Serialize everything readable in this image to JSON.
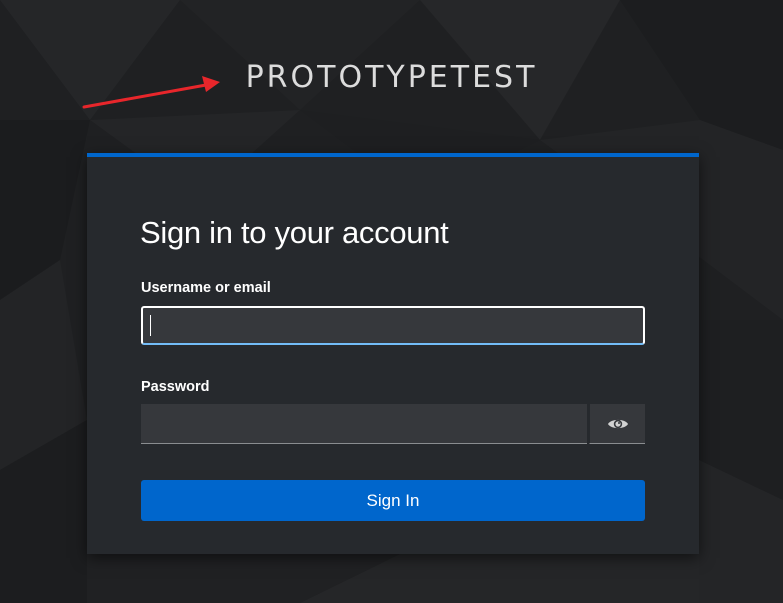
{
  "realm": {
    "name": "PROTOTYPETEST"
  },
  "login": {
    "title": "Sign in to your account",
    "username_label": "Username or email",
    "username_value": "",
    "password_label": "Password",
    "password_value": "",
    "show_password_icon": "eye-icon",
    "submit_label": "Sign In"
  },
  "colors": {
    "accent": "#0066cc",
    "card_background": "#26292d",
    "input_background": "#36383c",
    "page_background": "#1d1e20",
    "annotation_arrow": "#e8262b",
    "focus_underline": "#73bcf7"
  }
}
